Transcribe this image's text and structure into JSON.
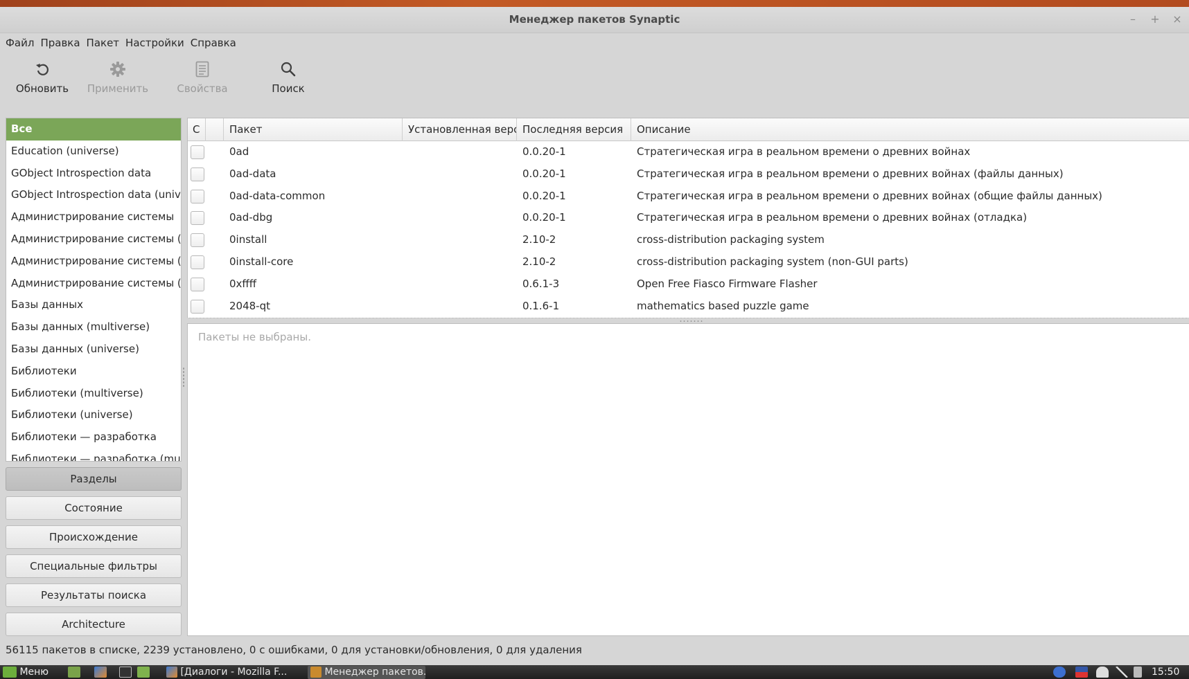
{
  "window": {
    "title": "Менеджер пакетов Synaptic",
    "controls": [
      "–",
      "+",
      "×"
    ]
  },
  "menu": [
    "Файл",
    "Правка",
    "Пакет",
    "Настройки",
    "Справка"
  ],
  "toolbar": {
    "reload": {
      "label": "Обновить",
      "icon": "refresh-icon"
    },
    "apply": {
      "label": "Применить",
      "icon": "gear-icon"
    },
    "properties": {
      "label": "Свойства",
      "icon": "properties-icon"
    },
    "search": {
      "label": "Поиск",
      "icon": "search-icon"
    }
  },
  "sections": [
    "Все",
    "Education (universe)",
    "GObject Introspection data",
    "GObject Introspection data (universe)",
    "Администрирование системы",
    "Администрирование системы (multiverse)",
    "Администрирование системы (restricted)",
    "Администрирование системы (universe)",
    "Базы данных",
    "Базы данных (multiverse)",
    "Базы данных (universe)",
    "Библиотеки",
    "Библиотеки (multiverse)",
    "Библиотеки (universe)",
    "Библиотеки — разработка",
    "Библиотеки — разработка (multiverse)"
  ],
  "filters": [
    "Разделы",
    "Состояние",
    "Происхождение",
    "Специальные фильтры",
    "Результаты поиска",
    "Architecture"
  ],
  "table": {
    "headers": {
      "status": "С",
      "package": "Пакет",
      "installed": "Установленная версия",
      "latest": "Последняя версия",
      "description": "Описание"
    },
    "rows": [
      {
        "package": "0ad",
        "installed": "",
        "latest": "0.0.20-1",
        "description": "Стратегическая игра в реальном времени о древних войнах"
      },
      {
        "package": "0ad-data",
        "installed": "",
        "latest": "0.0.20-1",
        "description": "Стратегическая игра в реальном времени о древних войнах (файлы данных)"
      },
      {
        "package": "0ad-data-common",
        "installed": "",
        "latest": "0.0.20-1",
        "description": "Стратегическая игра в реальном времени о древних войнах (общие файлы данных)"
      },
      {
        "package": "0ad-dbg",
        "installed": "",
        "latest": "0.0.20-1",
        "description": "Стратегическая игра в реальном времени о древних войнах (отладка)"
      },
      {
        "package": "0install",
        "installed": "",
        "latest": "2.10-2",
        "description": "cross-distribution packaging system"
      },
      {
        "package": "0install-core",
        "installed": "",
        "latest": "2.10-2",
        "description": "cross-distribution packaging system (non-GUI parts)"
      },
      {
        "package": "0xffff",
        "installed": "",
        "latest": "0.6.1-3",
        "description": "Open Free Fiasco Firmware Flasher"
      },
      {
        "package": "2048-qt",
        "installed": "",
        "latest": "0.1.6-1",
        "description": "mathematics based puzzle game"
      }
    ]
  },
  "details": {
    "empty_text": "Пакеты не выбраны."
  },
  "status": "56115 пакетов в списке, 2239 установлено, 0 с ошибками, 0 для установки/обновления, 0 для удаления",
  "taskbar": {
    "menu_label": "Меню",
    "windows": [
      "[Диалоги - Mozilla F...",
      "Менеджер пакетов..."
    ],
    "clock": "15:50"
  },
  "colors": {
    "selected_section": "#7ba658",
    "desktop_accent": "#b24b1f"
  }
}
